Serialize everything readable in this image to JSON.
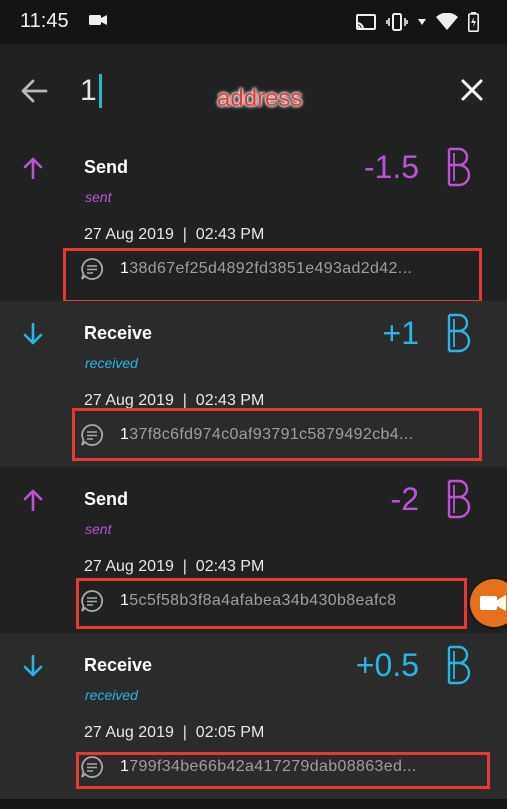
{
  "status_bar": {
    "time": "11:45",
    "icons": [
      "camera-icon",
      "cast-icon",
      "vibrate-icon",
      "wifi-icon",
      "battery-icon"
    ]
  },
  "search": {
    "query": "1",
    "annotation": "address",
    "back_icon": "arrow-left-icon",
    "close_icon": "close-icon"
  },
  "colors": {
    "sent": "#bb55d6",
    "received": "#29b6e6",
    "highlight": "#e53935"
  },
  "transactions": [
    {
      "type": "Send",
      "status": "sent",
      "amount": "-1.5",
      "currency_icon": "beam-coin-icon",
      "date": "27 Aug 2019  |  02:43 PM",
      "hash_prefix": "1",
      "hash_rest": "38d67ef25d4892fd3851e493ad2d42..."
    },
    {
      "type": "Receive",
      "status": "received",
      "amount": "+1",
      "currency_icon": "beam-coin-icon",
      "date": "27 Aug 2019  |  02:43 PM",
      "hash_prefix": "1",
      "hash_rest": "37f8c6fd974c0af93791c5879492cb4..."
    },
    {
      "type": "Send",
      "status": "sent",
      "amount": "-2",
      "currency_icon": "beam-coin-icon",
      "date": "27 Aug 2019  |  02:43 PM",
      "hash_prefix": "1",
      "hash_rest": "5c5f58b3f8a4afabea34b430b8eafc8"
    },
    {
      "type": "Receive",
      "status": "received",
      "amount": "+0.5",
      "currency_icon": "beam-coin-icon",
      "date": "27 Aug 2019  |  02:05 PM",
      "hash_prefix": "1",
      "hash_rest": "799f34be66b42a417279dab08863ed..."
    }
  ]
}
